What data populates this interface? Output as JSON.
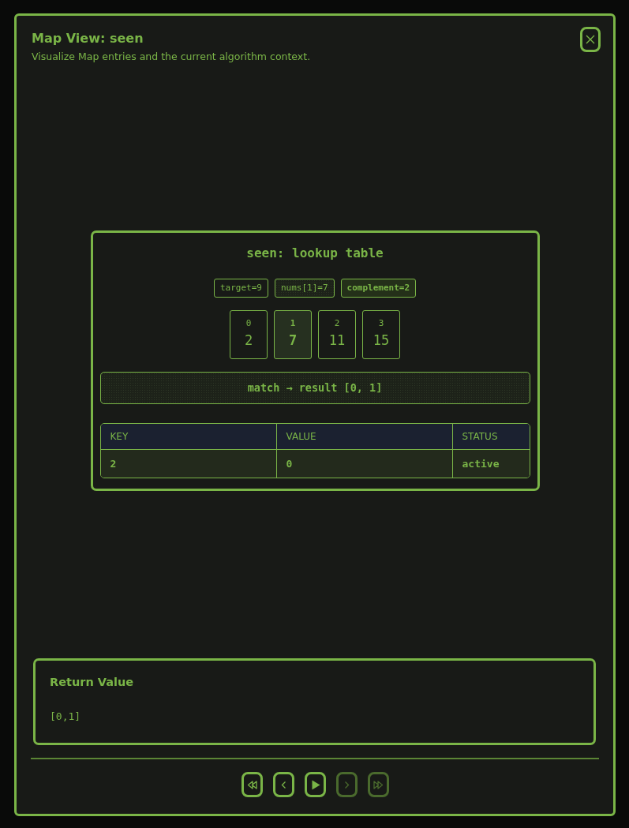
{
  "dialog": {
    "title": "Map View: seen",
    "subtitle": "Visualize Map entries and the current algorithm context."
  },
  "card": {
    "title": "seen: lookup table",
    "chips": [
      {
        "text": "target=9",
        "kind": "plain"
      },
      {
        "text": "nums[1]=7",
        "kind": "current"
      },
      {
        "text": "complement=2",
        "kind": "found"
      }
    ],
    "array": [
      {
        "index": "0",
        "value": "2",
        "selected": false
      },
      {
        "index": "1",
        "value": "7",
        "selected": true
      },
      {
        "index": "2",
        "value": "11",
        "selected": false
      },
      {
        "index": "3",
        "value": "15",
        "selected": false
      }
    ],
    "banner": "match → result [0, 1]",
    "table": {
      "columns": [
        "KEY",
        "VALUE",
        "STATUS"
      ],
      "rows": [
        [
          "2",
          "0",
          "active"
        ]
      ]
    }
  },
  "return_value": {
    "title": "Return Value",
    "value": "[0,1]"
  },
  "controls": [
    {
      "kind": "first",
      "disabled": false
    },
    {
      "kind": "prev",
      "disabled": false
    },
    {
      "kind": "play",
      "disabled": false
    },
    {
      "kind": "next",
      "disabled": true
    },
    {
      "kind": "last",
      "disabled": true
    }
  ]
}
